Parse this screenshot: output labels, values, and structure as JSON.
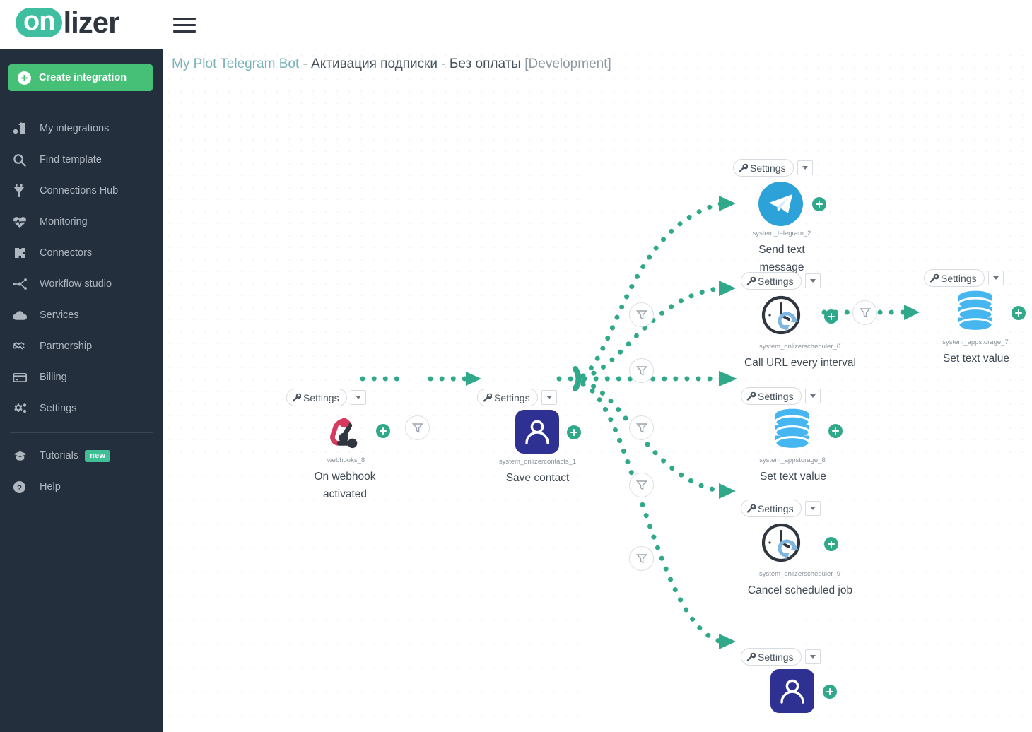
{
  "brand": {
    "logo_on": "on",
    "logo_rest": "lizer"
  },
  "topbar": {
    "menu_icon": "hamburger-icon"
  },
  "sidebar": {
    "create_button": {
      "label": "Create integration",
      "icon": "plus-icon",
      "color": "#46c077"
    },
    "items": [
      {
        "label": "My integrations",
        "icon": "integrations-icon"
      },
      {
        "label": "Find template",
        "icon": "search-icon"
      },
      {
        "label": "Connections Hub",
        "icon": "plug-icon"
      },
      {
        "label": "Monitoring",
        "icon": "heartbeat-icon"
      },
      {
        "label": "Connectors",
        "icon": "puzzle-icon"
      },
      {
        "label": "Workflow studio",
        "icon": "workflow-icon"
      },
      {
        "label": "Services",
        "icon": "cloud-icon"
      },
      {
        "label": "Partnership",
        "icon": "handshake-icon"
      },
      {
        "label": "Billing",
        "icon": "credit-card-icon"
      },
      {
        "label": "Settings",
        "icon": "gears-icon"
      }
    ],
    "footer_items": [
      {
        "label": "Tutorials",
        "icon": "graduation-cap-icon",
        "badge": "new",
        "badge_color": "#3fbf96"
      },
      {
        "label": "Help",
        "icon": "question-circle-icon"
      }
    ]
  },
  "canvas": {
    "title": {
      "main": "My Plot Telegram Bot",
      "dash1": " - ",
      "sub": "Активация подписки",
      "dash2": " - ",
      "sub2": "Без оплаты",
      "env": "[Development]"
    },
    "settings_label": "Settings",
    "nodes": [
      {
        "id": "webhooks_8",
        "title": "On webhook activated",
        "icon": "webhook-icon",
        "color": "#d63a5e"
      },
      {
        "id": "system_onlizercontacts_1",
        "title": "Save contact",
        "icon": "contact-icon",
        "color": "#2e3192"
      },
      {
        "id": "system_telegram_2",
        "title": "Send text message",
        "icon": "telegram-icon",
        "color": "#2da2d8"
      },
      {
        "id": "system_onlizerscheduler_6",
        "title": "Call URL every interval",
        "icon": "clock-sync-icon",
        "color": "#2f3640"
      },
      {
        "id": "system_appstorage_8",
        "title": "Set text value",
        "icon": "database-icon",
        "color": "#45b6f0"
      },
      {
        "id": "system_onlizerscheduler_9",
        "title": "Cancel scheduled job",
        "icon": "clock-sync-icon",
        "color": "#2f3640"
      },
      {
        "id": "system_appstorage_7",
        "title": "Set text value",
        "icon": "database-icon",
        "color": "#45b6f0"
      },
      {
        "id": "",
        "title": "",
        "icon": "contact-icon",
        "color": "#2e3192"
      }
    ],
    "filters_count": 7,
    "edge_color": "#2fa98a"
  }
}
